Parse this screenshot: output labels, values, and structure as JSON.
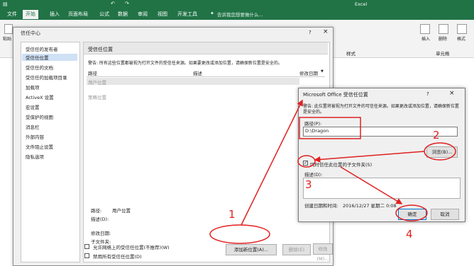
{
  "app": {
    "title": "Excel",
    "tabs": [
      "文件",
      "开始",
      "插入",
      "页面布局",
      "公式",
      "数据",
      "审阅",
      "视图",
      "开发工具"
    ],
    "active_tab": "开始",
    "tell_me": "告诉我您想要做什么...",
    "ribbon_groups": [
      "样式",
      "单元格"
    ],
    "ribbon_buttons": [
      "插入",
      "删除",
      "格式"
    ],
    "paste_label": "粘贴"
  },
  "trust_center": {
    "title": "信任中心",
    "help": "?",
    "close": "×",
    "nav": [
      "受信任的发布者",
      "受信任位置",
      "受信任的文档",
      "受信任的加载项目录",
      "加载项",
      "ActiveX 设置",
      "宏设置",
      "受保护的视图",
      "消息栏",
      "外部内容",
      "文件阻止设置",
      "隐私选项"
    ],
    "nav_selected": "受信任位置",
    "section_title": "受信任位置",
    "warning": "警告: 所有这些位置都被视为打开文件的受信任来源。如果要更改或添加位置，请确保新位置是安全的。",
    "columns": [
      "路径",
      "描述",
      "修改日期"
    ],
    "sort_arrow": "▼",
    "user_locations": "用户位置",
    "policy_locations": "策略位置",
    "path_label": "路径:",
    "path_value": "用户位置",
    "description_label": "描述(D):",
    "modified_label": "修改日期:",
    "subfolders_label": "子文件夹:",
    "add_button": "添加新位置(A)...",
    "remove_button": "删除(E)",
    "modify_button": "修改(M)...",
    "allow_network": "允许网络上的受信任位置(不推荐)(W)",
    "disable_all": "禁用所有受信任位置(D)"
  },
  "location_dialog": {
    "title": "Microsoft Office 受信任位置",
    "help": "?",
    "close": "×",
    "warning": "警告: 此位置将被视为打开文件的可信任来源。如果更改或添加位置，请确保新位置是安全的。",
    "path_label": "路径(P):",
    "path_value": "D:\\Dragon",
    "browse_button": "浏览(B)...",
    "subfolders_checkbox": "同时信任此位置的子文件夹(S)",
    "subfolders_checked": true,
    "description_label": "描述(D):",
    "created_label": "创建日期和时间:",
    "created_value": "2016/12/27 星期二 0:08",
    "ok_button": "确定",
    "cancel_button": "取消"
  },
  "annotations": [
    "1",
    "2",
    "3",
    "4"
  ],
  "colors": {
    "excel_green": "#217346",
    "annotation_red": "#e02020"
  }
}
